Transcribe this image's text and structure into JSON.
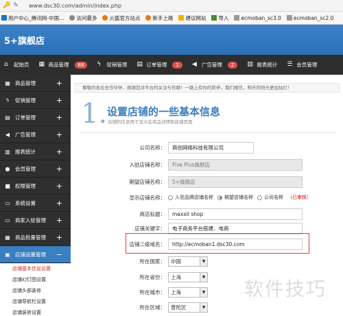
{
  "browser": {
    "url": "www.dsc30.com/admin/index.php",
    "bookmarks": [
      "用户中心_腾讯网-中国…",
      "访问最多",
      "火狐官方站点",
      "新手上路",
      "建议网站",
      "导入",
      "ecmoban_sc3.0",
      "ecmoban_sc2.0"
    ]
  },
  "header": {
    "title": "5+旗舰店"
  },
  "topnav": [
    {
      "label": "起始页"
    },
    {
      "label": "商品管理",
      "badge": "88"
    },
    {
      "label": "促销管理"
    },
    {
      "label": "订单管理",
      "badge": "1"
    },
    {
      "label": "广告管理",
      "badge": "2"
    },
    {
      "label": "报表统计"
    },
    {
      "label": "会员管理"
    }
  ],
  "sidebar": {
    "items": [
      {
        "label": "商品管理"
      },
      {
        "label": "促销管理"
      },
      {
        "label": "订单管理"
      },
      {
        "label": "广告管理"
      },
      {
        "label": "报表统计"
      },
      {
        "label": "会员管理"
      },
      {
        "label": "权限管理"
      },
      {
        "label": "系统设置"
      },
      {
        "label": "商家入驻管理"
      },
      {
        "label": "商品批量管理"
      },
      {
        "label": "店铺设置管理"
      }
    ],
    "sub_items": [
      "店铺基本信息设置",
      "店铺幻灯图设置",
      "店铺头部装修",
      "店铺导航栏设置",
      "店铺装修设置"
    ]
  },
  "main": {
    "notice": "尊敬的各位合作伙伴，感谢您对平台的关注与信赖！一路上有你的陪伴，我们相信，明天的阳光更加灿烂！",
    "step_number": "1.",
    "step_title": "设置店铺的一些基本信息",
    "step_subtitle": "店铺的信息用于显示在商品详情和店铺页面",
    "fields": {
      "company_label": "公司名称：",
      "company_value": "商创网络科技有限公司",
      "entry_label": "入驻店铺名称：",
      "entry_value": "Five Plus旗舰店",
      "expected_label": "期望店铺名称：",
      "expected_value": "5+旗舰店",
      "display_label": "显示店铺名称：",
      "display_opt1": "入驻品牌店铺名称",
      "display_opt2": "期望店铺名称",
      "display_opt3": "公司名称",
      "display_req": "（已审核）",
      "title_label": "商店标题：",
      "title_value": "maxxil shop",
      "keyword_label": "店铺关键字：",
      "keyword_value": "电子商务平台搭建、电商",
      "domain_label": "店铺二级域名：",
      "domain_value": "http://ecmoban1.dsc30.com",
      "country_label": "所在国家：",
      "country_value": "中国",
      "province_label": "所在省份：",
      "province_value": "上海",
      "city_label": "所在城市：",
      "city_value": "上海",
      "district_label": "所在区域：",
      "district_value": "普陀区"
    }
  },
  "watermark": "软件技巧",
  "colors": {
    "brand": "#2b6fb4",
    "dark_nav": "#2d2d2d",
    "highlight": "#e03a3a"
  }
}
